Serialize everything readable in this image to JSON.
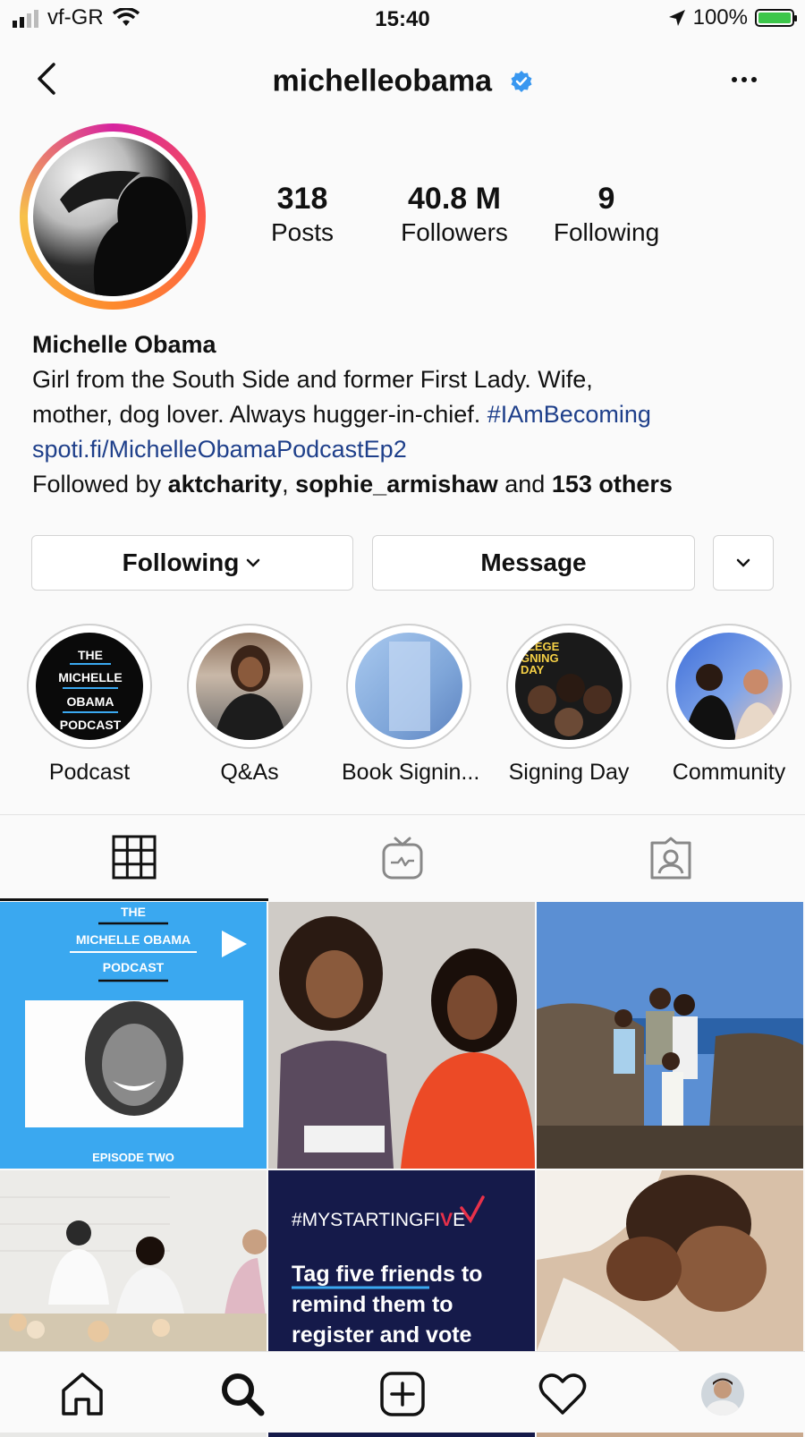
{
  "status_bar": {
    "carrier": "vf-GR",
    "time": "15:40",
    "battery": "100%"
  },
  "header": {
    "username": "michelleobama"
  },
  "profile": {
    "stats": [
      {
        "value": "318",
        "label": "Posts"
      },
      {
        "value": "40.8 M",
        "label": "Followers"
      },
      {
        "value": "9",
        "label": "Following"
      }
    ],
    "name": "Michelle Obama",
    "bio_line1": "Girl from the South Side and former First Lady. Wife,",
    "bio_line2_text": "mother, dog lover. Always hugger-in-chief. ",
    "bio_hashtag": "#IAmBecoming",
    "website": "spoti.fi/MichelleObamaPodcastEp2",
    "followed_by_prefix": "Followed by ",
    "followed_by_user1": "aktcharity",
    "followed_by_sep": ", ",
    "followed_by_user2": "sophie_armishaw",
    "followed_by_and": " and ",
    "followed_by_others": "153 others"
  },
  "actions": {
    "following_label": "Following",
    "message_label": "Message"
  },
  "highlights": [
    {
      "label": "Podcast",
      "text": [
        "THE",
        "MICHELLE",
        "OBAMA",
        "PODCAST"
      ]
    },
    {
      "label": "Q&As"
    },
    {
      "label": "Book Signin..."
    },
    {
      "label": "Signing Day",
      "text": [
        "LLEGE",
        "GNING",
        "DAY"
      ]
    },
    {
      "label": "Community"
    }
  ],
  "grid_posts": {
    "post1": {
      "line1": "THE",
      "line2": "MICHELLE OBAMA",
      "line3": "PODCAST",
      "footer": "EPISODE TWO"
    },
    "post5": {
      "tag_prefix": "#MYSTARTINGFI",
      "tag_v": "V",
      "tag_suffix": "E",
      "line1": "Tag five friends to",
      "line2": "remind them to",
      "line3": "register and vote"
    }
  },
  "colors": {
    "link": "#1e3f8a",
    "podcast_blue": "#3aa8f0",
    "starting_five_bg": "#151a4a",
    "check_red": "#e8314a"
  }
}
